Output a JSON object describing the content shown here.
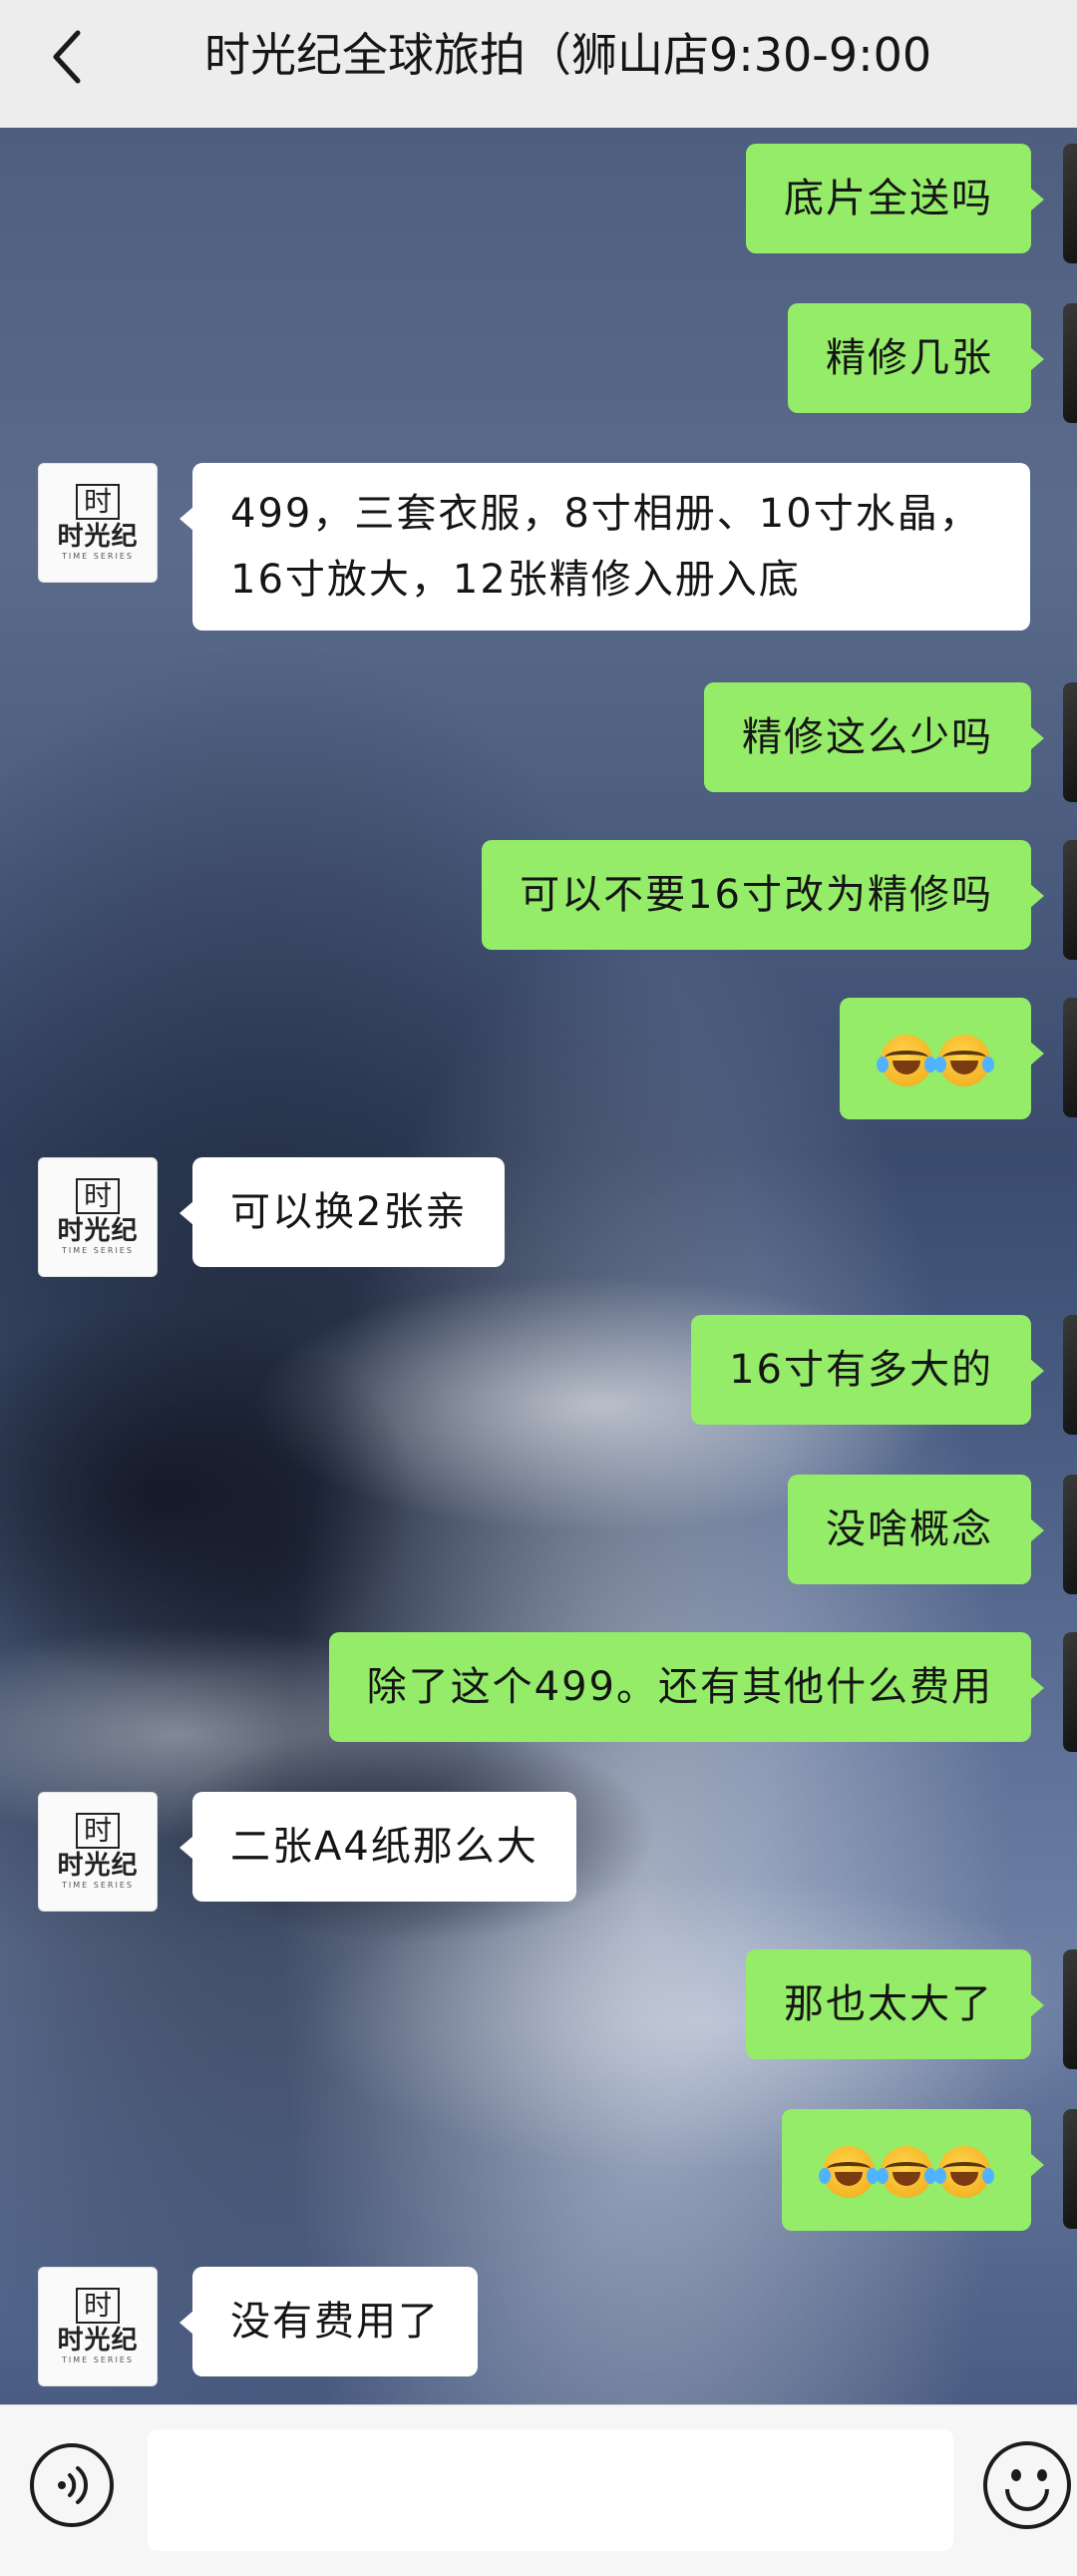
{
  "header": {
    "title": "时光纪全球旅拍（狮山店9:30-9:00",
    "back_icon": "chevron-left-icon"
  },
  "contact": {
    "avatar_mono": "时",
    "avatar_brand": "时光纪",
    "avatar_sub": "TIME SERIES"
  },
  "messages": [
    {
      "from": "me",
      "text": "底片全送吗"
    },
    {
      "from": "me",
      "text": "精修几张"
    },
    {
      "from": "them",
      "text": "499，三套衣服，8寸相册、10寸水晶，16寸放大，12张精修入册入底"
    },
    {
      "from": "me",
      "text": "精修这么少吗"
    },
    {
      "from": "me",
      "text": "可以不要16寸改为精修吗"
    },
    {
      "from": "me",
      "emoji": "loudly-crying-face",
      "count": 2
    },
    {
      "from": "them",
      "text": "可以换2张亲"
    },
    {
      "from": "me",
      "text": "16寸有多大的"
    },
    {
      "from": "me",
      "text": "没啥概念"
    },
    {
      "from": "me",
      "text": "除了这个499。还有其他什么费用"
    },
    {
      "from": "them",
      "text": "二张A4纸那么大"
    },
    {
      "from": "me",
      "text": "那也太大了"
    },
    {
      "from": "me",
      "emoji": "loudly-crying-face",
      "count": 3
    },
    {
      "from": "them",
      "text": "没有费用了"
    }
  ],
  "input_bar": {
    "voice_icon": "voice-input-icon",
    "input_value": "",
    "emoji_icon": "emoji-smile-icon"
  }
}
